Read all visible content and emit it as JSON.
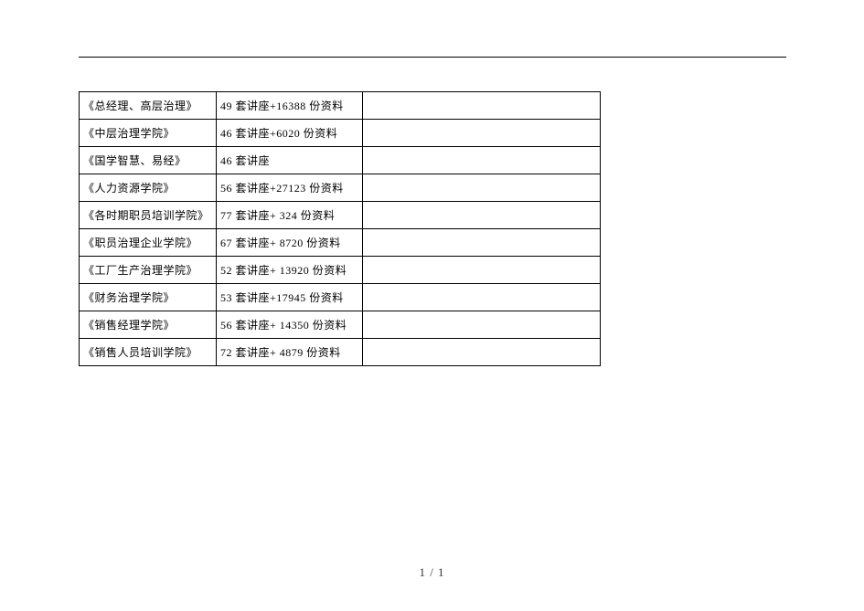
{
  "table": {
    "rows": [
      {
        "c1": "《总经理、高层治理》",
        "c2": "49 套讲座+16388 份资料",
        "c3": ""
      },
      {
        "c1": "《中层治理学院》",
        "c2": "46 套讲座+6020 份资料",
        "c3": ""
      },
      {
        "c1": "《国学智慧、易经》",
        "c2": "46 套讲座",
        "c3": ""
      },
      {
        "c1": "《人力资源学院》",
        "c2": "56 套讲座+27123 份资料",
        "c3": ""
      },
      {
        "c1": "《各时期职员培训学院》",
        "c2": "77 套讲座+ 324 份资料",
        "c3": ""
      },
      {
        "c1": "《职员治理企业学院》",
        "c2": "67 套讲座+ 8720 份资料",
        "c3": ""
      },
      {
        "c1": "《工厂生产治理学院》",
        "c2": "52 套讲座+ 13920 份资料",
        "c3": ""
      },
      {
        "c1": "《财务治理学院》",
        "c2": "53 套讲座+17945 份资料",
        "c3": ""
      },
      {
        "c1": "《销售经理学院》",
        "c2": "56 套讲座+ 14350 份资料",
        "c3": ""
      },
      {
        "c1": "《销售人员培训学院》",
        "c2": "72 套讲座+ 4879 份资料",
        "c3": ""
      }
    ]
  },
  "pager": "1 / 1"
}
